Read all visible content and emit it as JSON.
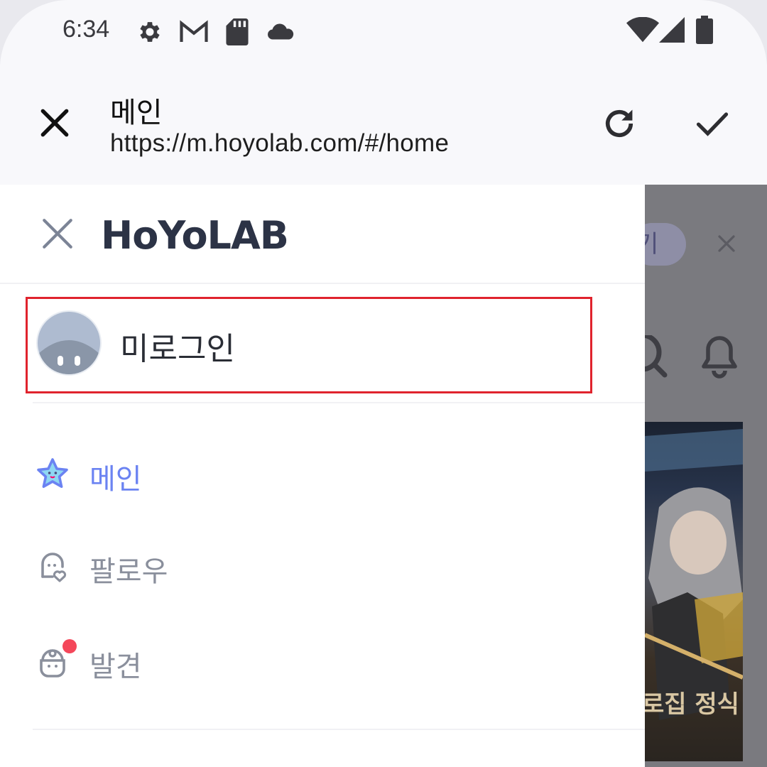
{
  "status_bar": {
    "time": "6:34",
    "left_icons": [
      "settings-icon",
      "gmail-icon",
      "sd-card-icon",
      "cloud-icon"
    ],
    "right_icons": [
      "wifi-icon",
      "signal-icon",
      "battery-icon"
    ]
  },
  "toolbar": {
    "title": "메인",
    "url": "https://m.hoyolab.com/#/home",
    "actions": [
      "close-icon",
      "refresh-icon",
      "check-icon"
    ]
  },
  "drawer": {
    "logo": "HoYoLAB",
    "login_label": "미로그인",
    "nav": [
      {
        "label": "메인",
        "icon": "star-icon",
        "active": true
      },
      {
        "label": "팔로우",
        "icon": "follow-icon",
        "active": false
      },
      {
        "label": "발견",
        "icon": "discover-icon",
        "active": false,
        "badge": true
      }
    ]
  },
  "background_page": {
    "chip_text": "기",
    "banner_text": "로집 정식"
  },
  "colors": {
    "accent": "#6b83f2",
    "highlight_border": "#e0232d",
    "badge": "#f4475a",
    "logo": "#2c3346"
  }
}
